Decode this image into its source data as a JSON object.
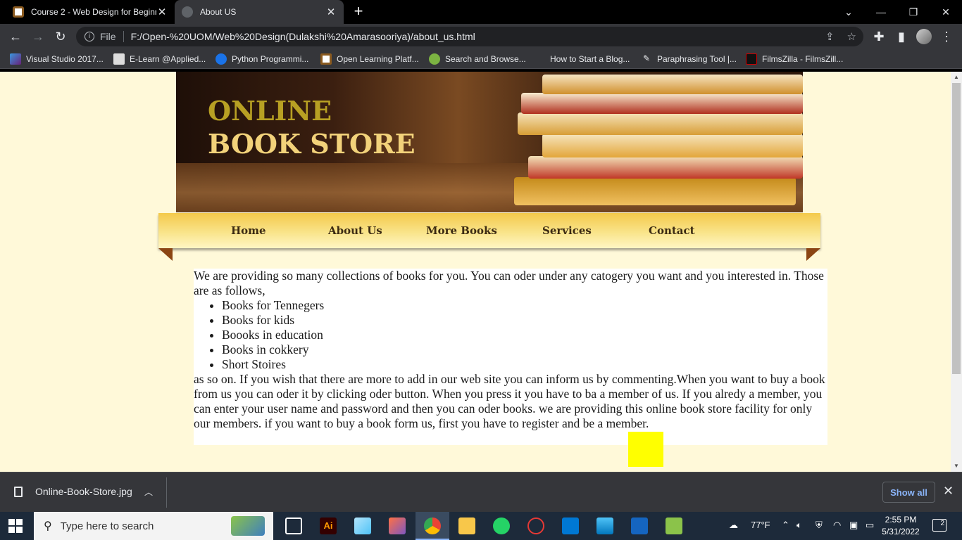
{
  "browser": {
    "tabs": [
      {
        "title": "Course 2 - Web Design for Beginners",
        "active": false
      },
      {
        "title": "About US",
        "active": true
      }
    ],
    "new_tab_label": "+",
    "address": {
      "scheme_label": "File",
      "url": "F:/Open-%20UOM/Web%20Design(Dulakshi%20Amarasooriya)/about_us.html"
    },
    "bookmarks": [
      {
        "label": "Visual Studio 2017...",
        "icon": "visual-studio-icon"
      },
      {
        "label": "E-Learn @Applied...",
        "icon": "elearn-icon"
      },
      {
        "label": "Python Programmi...",
        "icon": "python-c-icon"
      },
      {
        "label": "Open Learning Platf...",
        "icon": "open-learning-icon"
      },
      {
        "label": "Search and Browse...",
        "icon": "search-browse-icon"
      },
      {
        "label": "How to Start a Blog...",
        "icon": "blog-icon"
      },
      {
        "label": "Paraphrasing Tool |...",
        "icon": "quill-icon"
      },
      {
        "label": "FilmsZilla - FilmsZill...",
        "icon": "filmszilla-icon"
      }
    ]
  },
  "page": {
    "banner": {
      "line1": "ONLINE",
      "line2": "BOOK STORE"
    },
    "nav": [
      "Home",
      "About Us",
      "More Books",
      "Services",
      "Contact"
    ],
    "intro": "We are providing so many collections of books for you. You can oder under any catogery you want and you interested in. Those are as follows,",
    "list": [
      "Books for Tennegers",
      "Books for kids",
      "Boooks in education",
      "Books in cokkery",
      "Short Stoires"
    ],
    "outro": "as so on. If you wish that there are more to add in our web site you can inform us by commenting.When you want to buy a book from us you can oder it by clicking oder button. When you press it you have to ba a member of us. If you alredy a member, you can enter your user name and password and then you can oder books. we are providing this online book store facility for only our members. if you want to buy a book form us, first you have to register and be a member."
  },
  "downloads": {
    "file": "Online-Book-Store.jpg",
    "show_all": "Show all"
  },
  "taskbar": {
    "search_placeholder": "Type here to search",
    "weather": "77°F",
    "time": "2:55 PM",
    "date": "5/31/2022",
    "notifications": "2"
  },
  "colors": {
    "page_bg": "#fff9d9",
    "banner_gold": "#b8a023",
    "banner_light": "#f2d27a",
    "nav_top": "#f4c94b",
    "fold": "#8b4513",
    "yellow_box": "#ffff00"
  }
}
